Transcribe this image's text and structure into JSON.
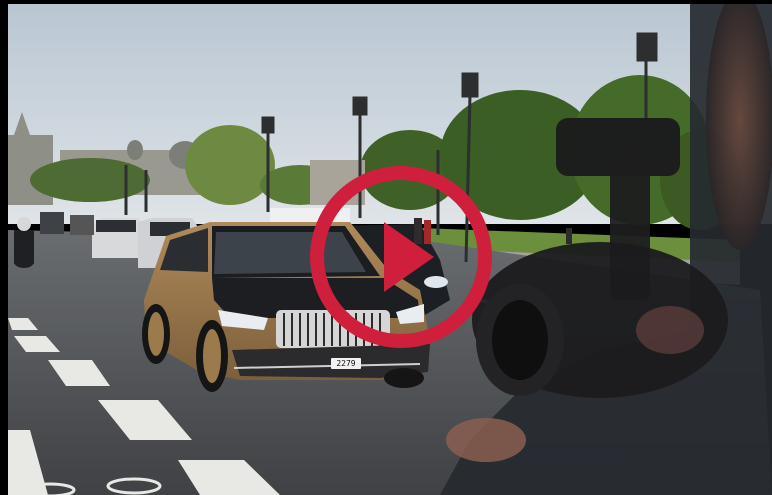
{
  "video": {
    "plate_text": "2279",
    "play_icon": "play-icon",
    "accent_color": "#d01f3c"
  }
}
